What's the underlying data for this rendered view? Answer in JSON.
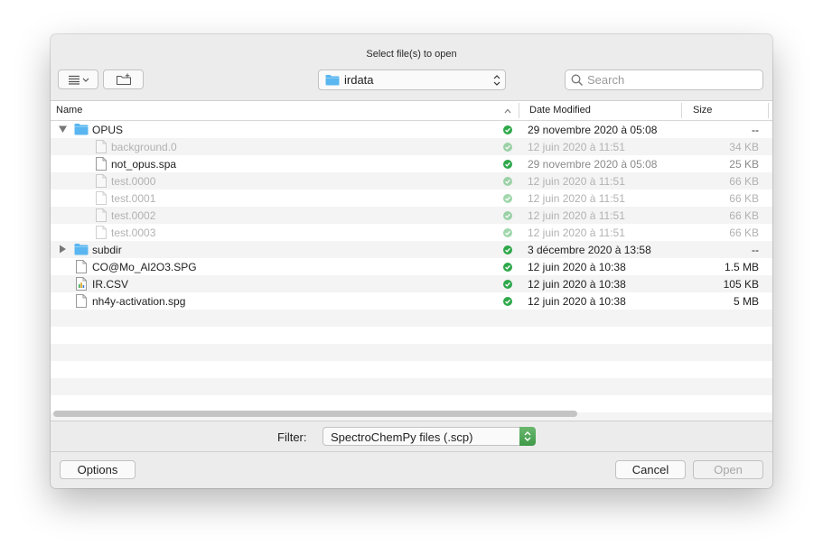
{
  "dialog": {
    "title": "Select file(s) to open"
  },
  "toolbar": {
    "view_icon": "list-view-icon",
    "new_folder_icon": "new-folder-icon",
    "location": "irdata",
    "search_placeholder": "Search"
  },
  "columns": {
    "name": "Name",
    "date": "Date Modified",
    "size": "Size"
  },
  "files": [
    {
      "name": "OPUS",
      "date": "29 novembre 2020 à 05:08",
      "size": "--"
    },
    {
      "name": "background.0",
      "date": "12 juin 2020 à 11:51",
      "size": "34 KB"
    },
    {
      "name": "not_opus.spa",
      "date": "29 novembre 2020 à 05:08",
      "size": "25 KB"
    },
    {
      "name": "test.0000",
      "date": "12 juin 2020 à 11:51",
      "size": "66 KB"
    },
    {
      "name": "test.0001",
      "date": "12 juin 2020 à 11:51",
      "size": "66 KB"
    },
    {
      "name": "test.0002",
      "date": "12 juin 2020 à 11:51",
      "size": "66 KB"
    },
    {
      "name": "test.0003",
      "date": "12 juin 2020 à 11:51",
      "size": "66 KB"
    },
    {
      "name": "subdir",
      "date": "3 décembre 2020 à 13:58",
      "size": "--"
    },
    {
      "name": "CO@Mo_Al2O3.SPG",
      "date": "12 juin 2020 à 10:38",
      "size": "1.5 MB"
    },
    {
      "name": "IR.CSV",
      "date": "12 juin 2020 à 10:38",
      "size": "105 KB"
    },
    {
      "name": "nh4y-activation.spg",
      "date": "12 juin 2020 à 10:38",
      "size": "5 MB"
    }
  ],
  "filter": {
    "label": "Filter:",
    "value": "SpectroChemPy files  (.scp)"
  },
  "buttons": {
    "options": "Options",
    "cancel": "Cancel",
    "open": "Open"
  },
  "colors": {
    "folder": "#5ab6f0",
    "check": "#2fa84a",
    "filter_arrow": "#4aa552"
  }
}
